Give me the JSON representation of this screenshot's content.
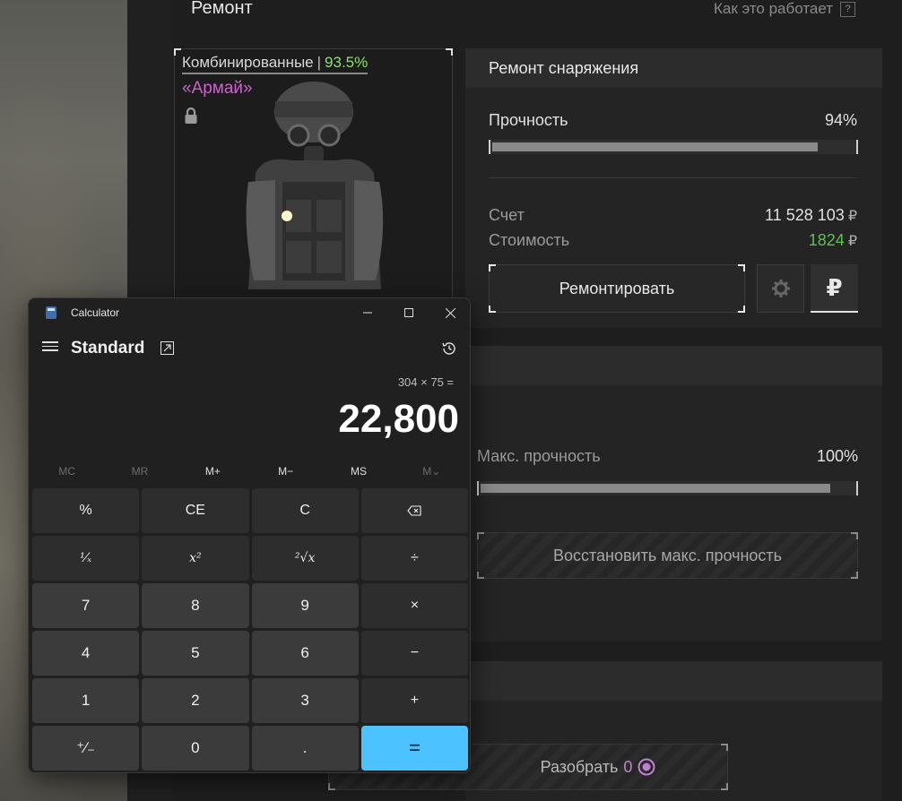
{
  "page": {
    "title": "Ремонт",
    "how_it_works": "Как это работает",
    "help_mark": "?"
  },
  "item": {
    "type_label": "Комбинированные",
    "type_sep": "|",
    "type_pct": "93.5%",
    "name": "«Армай»"
  },
  "repair": {
    "header": "Ремонт снаряжения",
    "durability_label": "Прочность",
    "durability_value": "94%",
    "durability_fraction": 0.94,
    "account_label": "Счет",
    "account_value": "11 528 103",
    "cost_label": "Стоимость",
    "cost_value": "1824",
    "currency_glyph": "₽",
    "repair_button": "Ремонтировать",
    "ruble_button": "₽"
  },
  "max": {
    "label": "Макс. прочность",
    "value": "100%",
    "fraction": 1.0,
    "restore_button": "Восстановить макс. прочность"
  },
  "disassemble": {
    "label": "Разобрать",
    "value": "0"
  },
  "calculator": {
    "title": "Calculator",
    "mode": "Standard",
    "expression": "304 × 75 =",
    "display": "22,800",
    "memory": [
      "MC",
      "MR",
      "M+",
      "M−",
      "MS",
      "M⌄"
    ],
    "keys": [
      "%",
      "CE",
      "C",
      "⌫",
      "¹⁄ₓ",
      "x²",
      "²√x",
      "÷",
      "7",
      "8",
      "9",
      "×",
      "4",
      "5",
      "6",
      "−",
      "1",
      "2",
      "3",
      "+",
      "⁺⁄₋",
      "0",
      ".",
      "="
    ]
  },
  "colors": {
    "accent_green": "#5fc04b",
    "item_name": "#d060d0",
    "calc_equals": "#4cc2ff"
  }
}
